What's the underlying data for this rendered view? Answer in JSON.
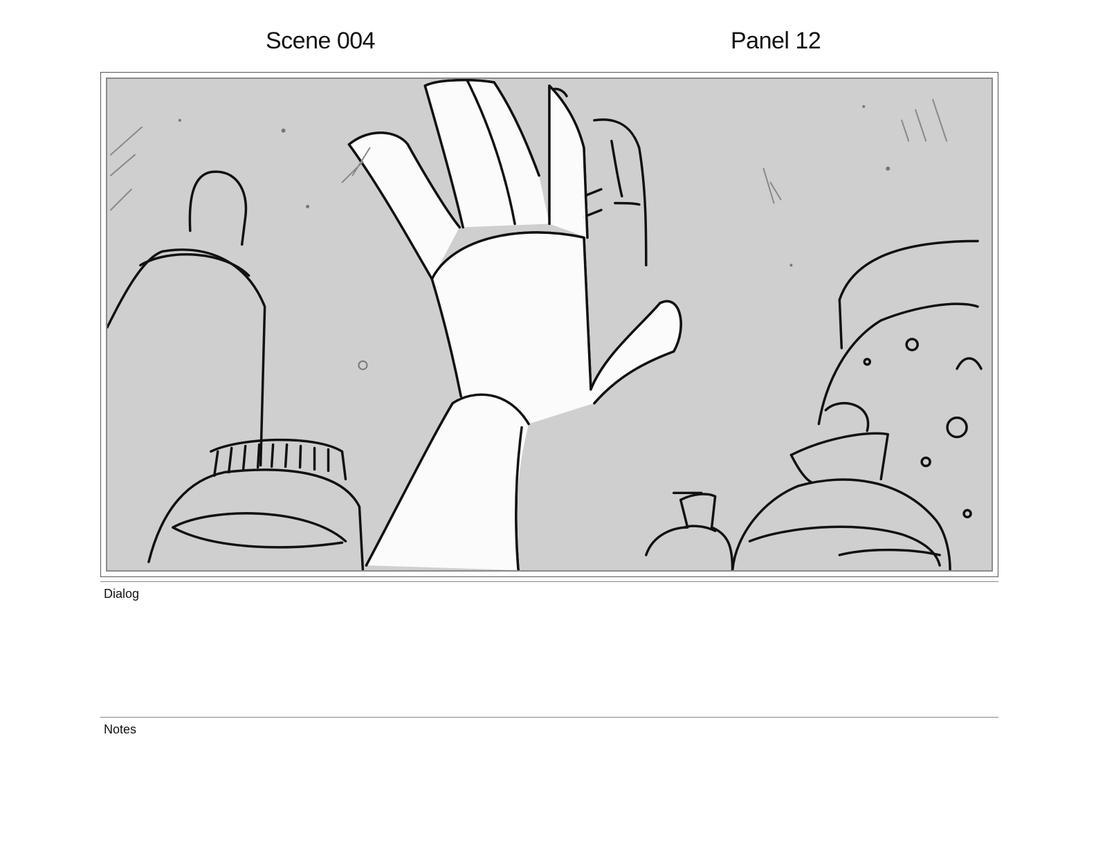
{
  "header": {
    "scene": "Scene 004",
    "panel": "Panel 12"
  },
  "dialog": {
    "label": "Dialog",
    "text": ""
  },
  "notes": {
    "label": "Notes",
    "text": ""
  },
  "colors": {
    "panel_background": "#cfcfcf",
    "ink": "#111111",
    "rule": "#888888"
  }
}
